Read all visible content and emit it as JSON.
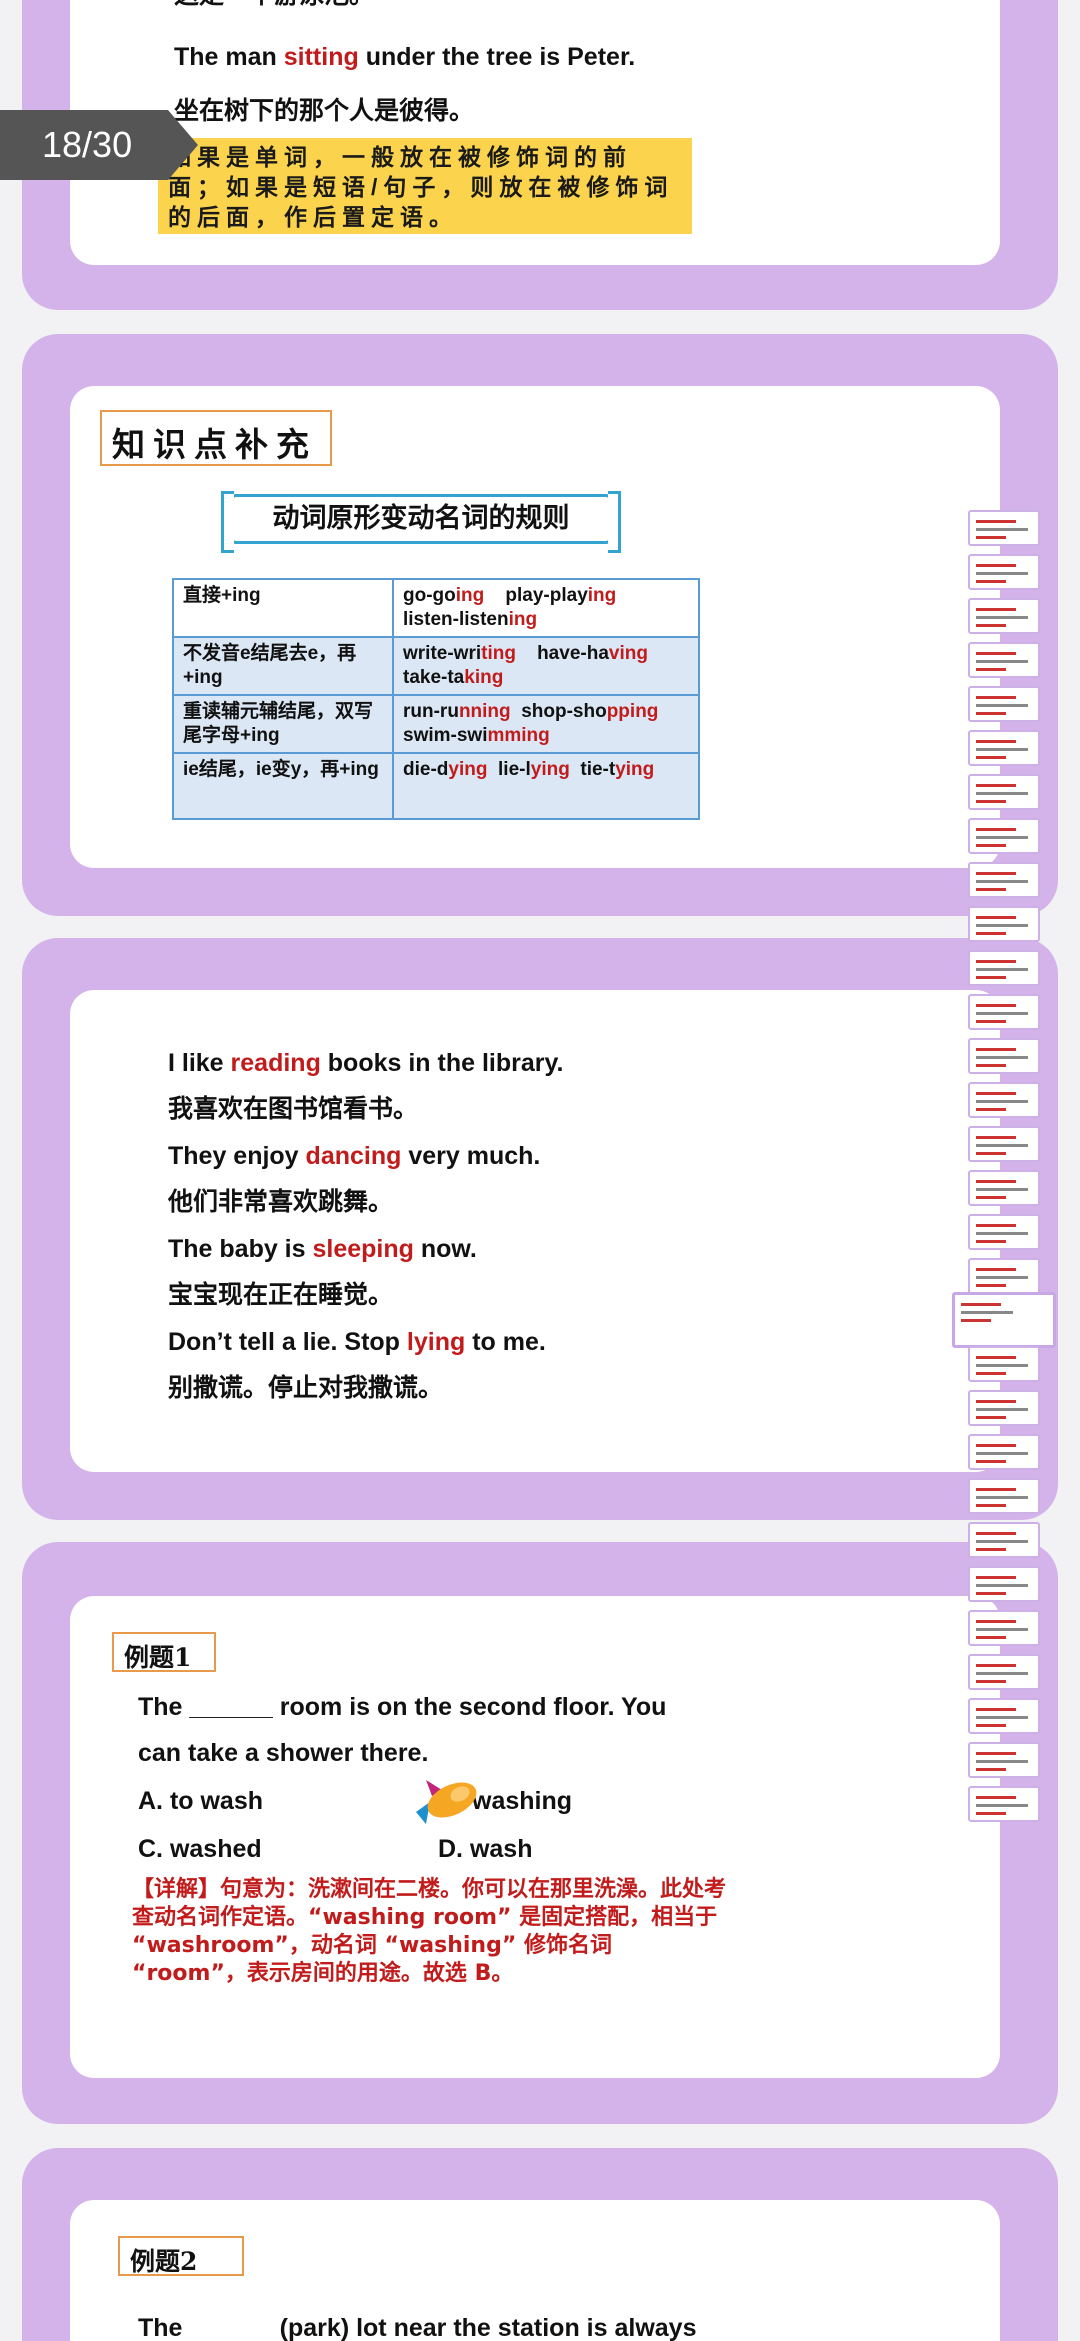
{
  "viewer": {
    "page_indicator": "18/30"
  },
  "slide_top": {
    "cut_line": "这是一个游泳池。",
    "en_pre": "The man ",
    "en_hl": "sitting",
    "en_post": " under the tree is Peter.",
    "zh": "坐在树下的那个人是彼得。",
    "note": "如果是单词，一般放在被修饰词的前面；如果是短语/句子，则放在被修饰词的后面，作后置定语。"
  },
  "slide_rules": {
    "section_title": "知识点补充",
    "banner": "动词原形变动名词的规则",
    "rows": [
      {
        "rule": "直接+ing",
        "l1a": "go-go",
        "l1ah": "ing",
        "l1b": "play-play",
        "l1bh": "ing",
        "l2a": "listen-listen",
        "l2ah": "ing",
        "l2b": "",
        "l2bh": ""
      },
      {
        "rule": "不发音e结尾去e，再+ing",
        "l1a": "write-wri",
        "l1ah": "ting",
        "l1b": "have-ha",
        "l1bh": "ving",
        "l2a": "take-ta",
        "l2ah": "king",
        "l2b": "",
        "l2bh": ""
      },
      {
        "rule": "重读辅元辅结尾，双写尾字母+ing",
        "l1a": "run-ru",
        "l1ah": "nning",
        "l1b": "shop-sho",
        "l1bh": "pping",
        "l2a": "swim-swi",
        "l2ah": "mming",
        "l2b": "",
        "l2bh": ""
      },
      {
        "rule": "ie结尾，ie变y，再+ing",
        "l1a": "die-d",
        "l1ah": "ying",
        "l1b": "lie-l",
        "l1bh": "ying",
        "l1c": "tie-t",
        "l1ch": "ying"
      }
    ]
  },
  "slide_examples": {
    "s1_pre": "I like ",
    "s1_hl": "reading",
    "s1_post": " books in the library.",
    "s1_zh": "我喜欢在图书馆看书。",
    "s2_pre": "They enjoy ",
    "s2_hl": "dancing",
    "s2_post": " very much.",
    "s2_zh": "他们非常喜欢跳舞。",
    "s3_pre": "The baby is ",
    "s3_hl": "sleeping",
    "s3_post": " now.",
    "s3_zh": "宝宝现在正在睡觉。",
    "s4_pre": "Don’t tell a lie. Stop ",
    "s4_hl": "lying",
    "s4_post": " to me.",
    "s4_zh": "别撒谎。停止对我撒谎。"
  },
  "slide_ex1": {
    "label": "例题1",
    "q_line1": "The ______ room is on the second floor. You",
    "q_line2": "can take a shower there.",
    "opt_a": "A.  to wash",
    "opt_b": "washing",
    "opt_c": "C. washed",
    "opt_d": "D. wash",
    "detail": "【详解】句意为：洗漱间在二楼。你可以在那里洗澡。此处考查动名词作定语。“washing room” 是固定搭配，相当于 “washroom”，动名词 “washing” 修饰名词 “room”，表示房间的用途。故选 B。"
  },
  "slide_ex2": {
    "label": "例题2",
    "q_line1": "The              (park) lot near the station is always"
  },
  "colors": {
    "highlight": "#c21b1b",
    "card": "#d4b3ea",
    "note_bg": "#fbd34d"
  }
}
